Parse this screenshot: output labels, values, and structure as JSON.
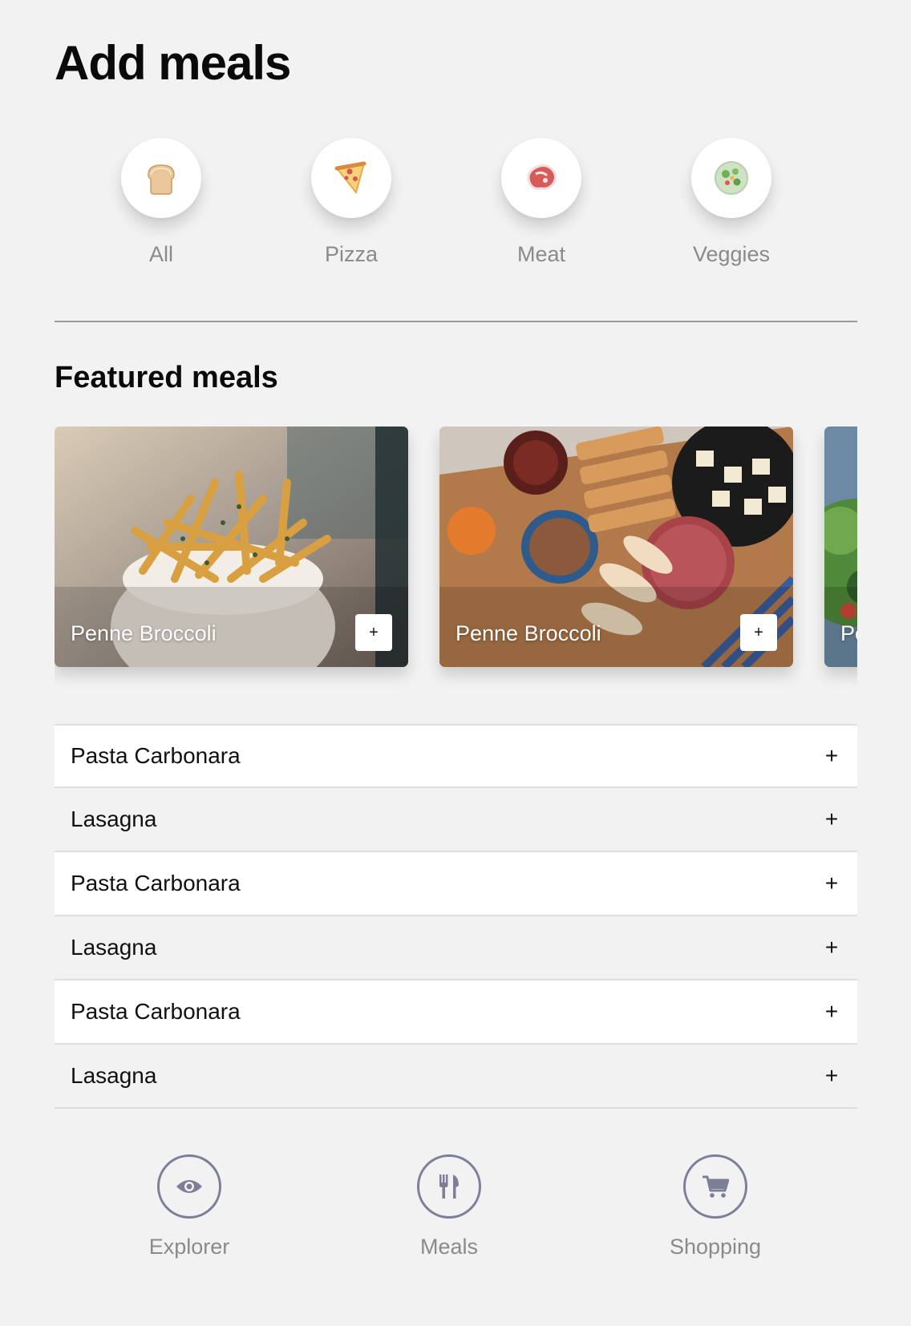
{
  "header": {
    "title": "Add meals"
  },
  "categories": [
    {
      "label": "All",
      "icon": "bread-icon"
    },
    {
      "label": "Pizza",
      "icon": "pizza-icon"
    },
    {
      "label": "Meat",
      "icon": "meat-icon"
    },
    {
      "label": "Veggies",
      "icon": "salad-icon"
    }
  ],
  "featured": {
    "title": "Featured meals",
    "cards": [
      {
        "title": "Penne Broccoli",
        "add_label": "+"
      },
      {
        "title": "Penne Broccoli",
        "add_label": "+"
      },
      {
        "title": "Pe",
        "add_label": "+"
      }
    ]
  },
  "meals": [
    {
      "name": "Pasta Carbonara",
      "add_label": "+"
    },
    {
      "name": "Lasagna",
      "add_label": "+"
    },
    {
      "name": "Pasta Carbonara",
      "add_label": "+"
    },
    {
      "name": "Lasagna",
      "add_label": "+"
    },
    {
      "name": "Pasta Carbonara",
      "add_label": "+"
    },
    {
      "name": "Lasagna",
      "add_label": "+"
    }
  ],
  "nav": [
    {
      "label": "Explorer",
      "icon": "eye-icon"
    },
    {
      "label": "Meals",
      "icon": "fork-knife-icon"
    },
    {
      "label": "Shopping",
      "icon": "cart-icon"
    }
  ],
  "colors": {
    "background": "#f2f2f2",
    "nav_ring": "#7d7f96",
    "muted_text": "#8a8a8a"
  }
}
